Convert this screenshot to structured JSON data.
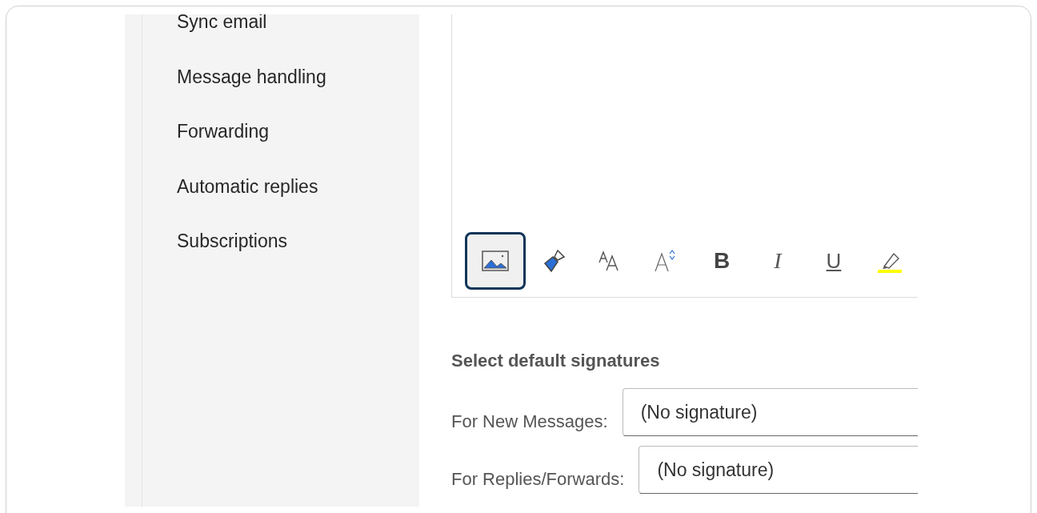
{
  "sidebar": {
    "items": [
      {
        "label": "Sync email"
      },
      {
        "label": "Message handling"
      },
      {
        "label": "Forwarding"
      },
      {
        "label": "Automatic replies"
      },
      {
        "label": "Subscriptions"
      }
    ]
  },
  "toolbar": {
    "buttons": [
      {
        "kind": "image",
        "focused": true
      },
      {
        "kind": "paint",
        "focused": false
      },
      {
        "kind": "font-size",
        "focused": false
      },
      {
        "kind": "grow",
        "focused": false
      },
      {
        "kind": "bold",
        "label": "B",
        "focused": false
      },
      {
        "kind": "italic",
        "label": "I",
        "focused": false
      },
      {
        "kind": "underline",
        "label": "U",
        "focused": false
      },
      {
        "kind": "highlight",
        "focused": false
      }
    ]
  },
  "default_signatures": {
    "heading": "Select default signatures",
    "rows": [
      {
        "label": "For New Messages:",
        "value": "(No signature)"
      },
      {
        "label": "For Replies/Forwards:",
        "value": "(No signature)"
      }
    ]
  }
}
